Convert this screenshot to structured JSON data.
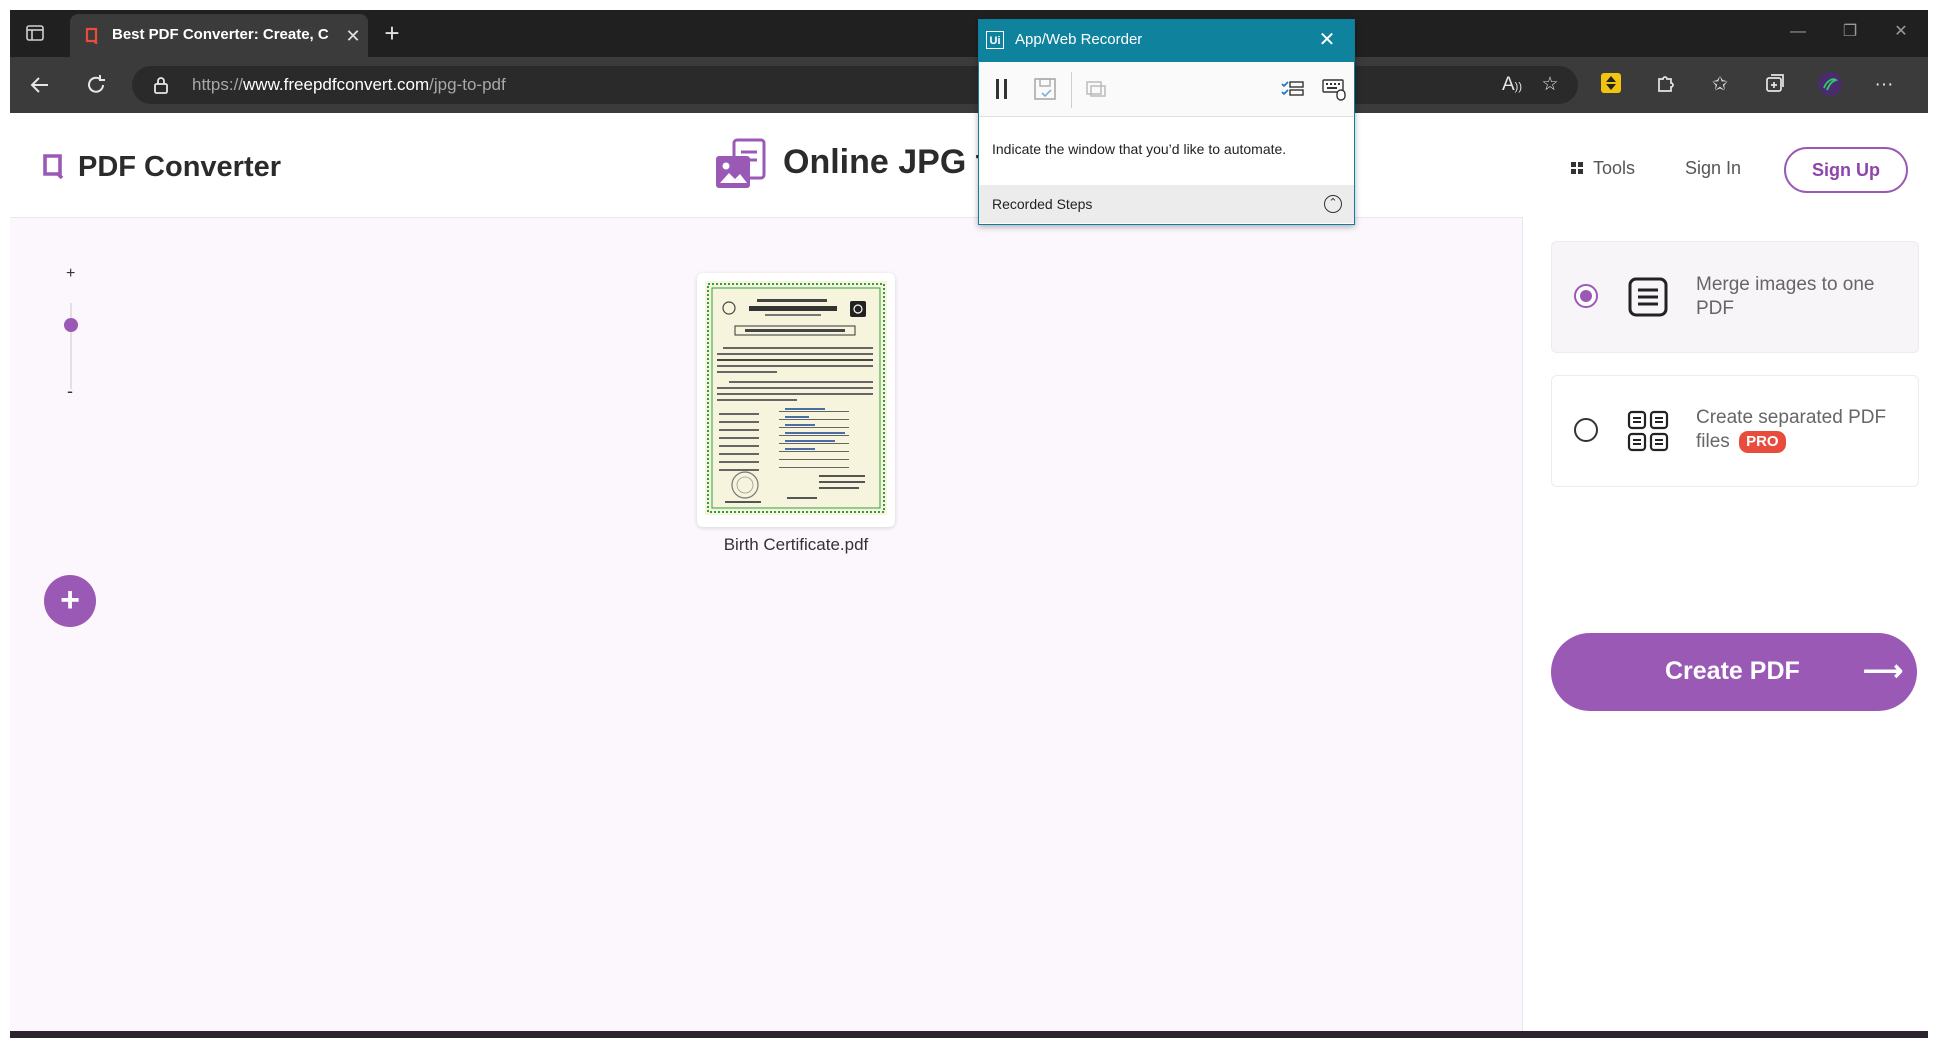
{
  "browser": {
    "tab_title": "Best PDF Converter: Create, C",
    "url_scheme": "https://",
    "url_host": "www.freepdfconvert.com",
    "url_path": "/jpg-to-pdf",
    "accent_color": "#9b59b6"
  },
  "header": {
    "logo_text": "PDF Converter",
    "hero_title": "Online JPG t",
    "tools_label": "Tools",
    "signin_label": "Sign In",
    "signup_label": "Sign Up"
  },
  "zoom": {
    "plus": "+",
    "minus": "-",
    "level": 0.75
  },
  "files": [
    {
      "name": "Birth Certificate.pdf"
    }
  ],
  "add_button": "+",
  "options": {
    "merge_label": "Merge images to one PDF",
    "separate_label": "Create separated PDF files",
    "pro_badge": "PRO",
    "selected": "merge"
  },
  "create_button": {
    "label": "Create PDF",
    "arrow": "⟶"
  },
  "recorder": {
    "logo": "Ui",
    "title": "App/Web Recorder",
    "message": "Indicate the window that you’d like to automate.",
    "steps_label": "Recorded Steps"
  }
}
